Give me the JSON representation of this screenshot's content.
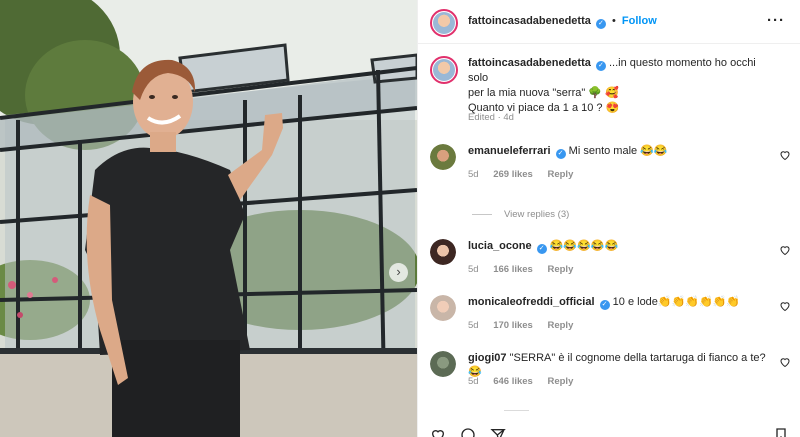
{
  "post": {
    "author": "fattoincasadabenedetta",
    "follow_label": "Follow",
    "more_label": "···",
    "caption_line1": "...in questo momento ho occhi solo",
    "caption_line2": "per la mia nuova \"serra\" 🌳 🥰",
    "caption_line3": "Quanto vi piace da 1 a 10 ? 😍",
    "edited": "Edited",
    "edited_time": "4d",
    "carousel_next": "›"
  },
  "comments": [
    {
      "user": "emanueleferrari",
      "verified": true,
      "text": "Mi sento male 😂😂",
      "time": "5d",
      "likes": "269 likes",
      "reply": "Reply"
    },
    {
      "user": "lucia_ocone",
      "verified": true,
      "text": "😂😂😂😂😂",
      "time": "5d",
      "likes": "166 likes",
      "reply": "Reply"
    },
    {
      "user": "monicaleofreddi_official",
      "verified": true,
      "text": "10 e lode👏👏👏👏👏👏",
      "time": "5d",
      "likes": "170 likes",
      "reply": "Reply"
    },
    {
      "user": "giogi07",
      "verified": false,
      "text": "\"SERRA\" è il cognome della tartaruga di fianco a te?😂",
      "time": "5d",
      "likes": "646 likes",
      "reply": "Reply"
    }
  ],
  "view_replies": "View replies (3)",
  "colors": {
    "accent": "#0095f6",
    "verified": "#3897f0",
    "story_ring": "#e1306c"
  },
  "icons": [
    "verified-icon",
    "heart-icon",
    "comment-icon",
    "share-icon",
    "bookmark-icon",
    "more-icon",
    "chevron-right-icon"
  ]
}
